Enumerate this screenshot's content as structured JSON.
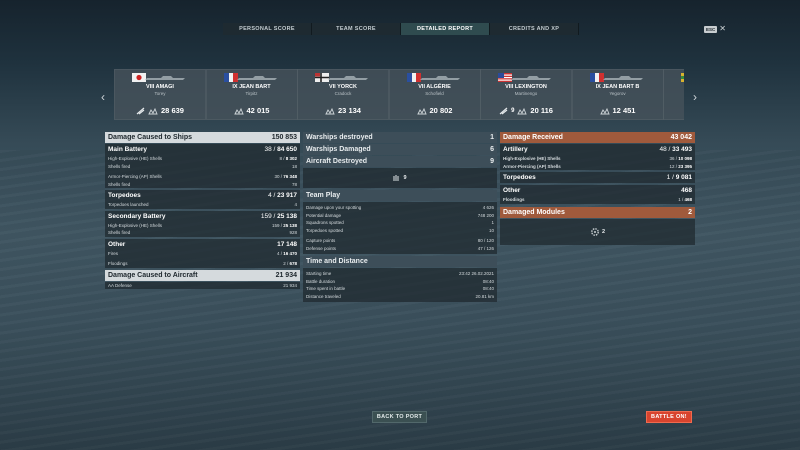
{
  "tabs": [
    {
      "label": "PERSONAL SCORE",
      "active": false
    },
    {
      "label": "TEAM SCORE",
      "active": false
    },
    {
      "label": "DETAILED REPORT",
      "active": true
    },
    {
      "label": "CREDITS AND XP",
      "active": false
    }
  ],
  "esc_key": "ESC",
  "ships": [
    {
      "tier_name": "VIII AMAGI",
      "player": "Torey",
      "damage": "28 639",
      "flag": "japan",
      "extras": [
        {
          "icon": "plane-icon"
        }
      ]
    },
    {
      "tier_name": "IX JEAN BART",
      "player": "Tirpitz",
      "damage": "42 015",
      "flag": "france",
      "extras": []
    },
    {
      "tier_name": "VII YORCK",
      "player": "Cradock",
      "damage": "23 134",
      "flag": "germany",
      "extras": []
    },
    {
      "tier_name": "VII ALGÉRIE",
      "player": "Schofield",
      "damage": "20 802",
      "flag": "france",
      "extras": []
    },
    {
      "tier_name": "VIII LEXINGTON",
      "player": "Martinengo",
      "damage": "20 116",
      "flag": "usa",
      "extras": [
        {
          "icon": "plane-icon",
          "value": "9"
        }
      ]
    },
    {
      "tier_name": "IX JEAN BART B",
      "player": "Yegorov",
      "damage": "12 451",
      "flag": "france",
      "extras": []
    },
    {
      "tier_name": "IX",
      "player": "",
      "damage": "",
      "flag": "other",
      "extras": []
    }
  ],
  "left": {
    "header": {
      "label": "Damage Caused to Ships",
      "value": "150 853"
    },
    "main_battery": {
      "label": "Main Battery",
      "value": "38 / 84 650",
      "rows": [
        {
          "label": "High-Explosive (HE) Shells",
          "a": "8 / ",
          "b": "8 302"
        },
        {
          "label": "Shells fired",
          "a": "18",
          "b": ""
        },
        {
          "label": "Armor-Piercing (AP) Shells",
          "a": "30 / ",
          "b": "76 348"
        },
        {
          "label": "Shells fired",
          "a": "78",
          "b": ""
        }
      ]
    },
    "torpedoes": {
      "label": "Torpedoes",
      "value": "4 / 23 917",
      "rows": [
        {
          "label": "Torpedoes launched",
          "a": "4",
          "b": ""
        }
      ]
    },
    "secondary": {
      "label": "Secondary Battery",
      "value": "159 / 25 138",
      "rows": [
        {
          "label": "High-Explosive (HE) Shells",
          "a": "159 / ",
          "b": "25 138"
        },
        {
          "label": "Shells fired",
          "a": "928",
          "b": ""
        }
      ]
    },
    "other": {
      "label": "Other",
      "value": "17 148",
      "rows": [
        {
          "label": "Fires",
          "a": "4 / ",
          "b": "16 470"
        },
        {
          "label": "Floodings",
          "a": "2 / ",
          "b": "678"
        }
      ]
    },
    "aircraft": {
      "label": "Damage Caused to Aircraft",
      "value": "21 934",
      "rows": [
        {
          "label": "AA Defense",
          "a": "21 934",
          "b": ""
        }
      ]
    }
  },
  "middle": {
    "warships_destroyed": {
      "label": "Warships destroyed",
      "value": "1"
    },
    "warships_damaged": {
      "label": "Warships Damaged",
      "value": "6"
    },
    "aircraft_destroyed": {
      "label": "Aircraft Destroyed",
      "value": "9"
    },
    "aircraft_count": "9",
    "team_play": {
      "label": "Team Play",
      "rows": [
        {
          "label": "Damage upon your spotting",
          "value": "4 626"
        },
        {
          "label": "Potential damage",
          "value": "748 200"
        },
        {
          "label": "Squadrons spotted",
          "value": "1"
        },
        {
          "label": "Torpedoes spotted",
          "value": "10"
        },
        {
          "label": "Capture points",
          "value": "80 / 120"
        },
        {
          "label": "Defense points",
          "value": "47 / 126"
        }
      ]
    },
    "time": {
      "label": "Time and Distance",
      "rows": [
        {
          "label": "Starting time",
          "value": "23:42   26.02.2021"
        },
        {
          "label": "Battle duration",
          "value": "08:40"
        },
        {
          "label": "Time spent in battle",
          "value": "08:40"
        },
        {
          "label": "Distance traveled",
          "value": "20.81 km"
        }
      ]
    }
  },
  "right": {
    "header": {
      "label": "Damage Received",
      "value": "43 042"
    },
    "artillery": {
      "label": "Artillery",
      "value": "48 / 33 493",
      "rows": [
        {
          "label": "High-Explosive (HE) Shells",
          "a": "36 / ",
          "b": "10 098"
        },
        {
          "label": "Armor-Piercing (AP) Shells",
          "a": "12 / ",
          "b": "23 395"
        }
      ]
    },
    "torpedoes": {
      "label": "Torpedoes",
      "value": "1 / 9 081"
    },
    "other": {
      "label": "Other",
      "value": "468",
      "rows": [
        {
          "label": "Floodings",
          "a": "1 / ",
          "b": "468"
        }
      ]
    },
    "modules": {
      "label": "Damaged Modules",
      "value": "2",
      "count": "2"
    }
  },
  "buttons": {
    "back": "BACK TO PORT",
    "battle": "BATTLE ON!"
  },
  "colors": {
    "accent_orange": "#a05a3c",
    "battle_red": "#d8442e",
    "active_tab": "#2f4b4f"
  }
}
